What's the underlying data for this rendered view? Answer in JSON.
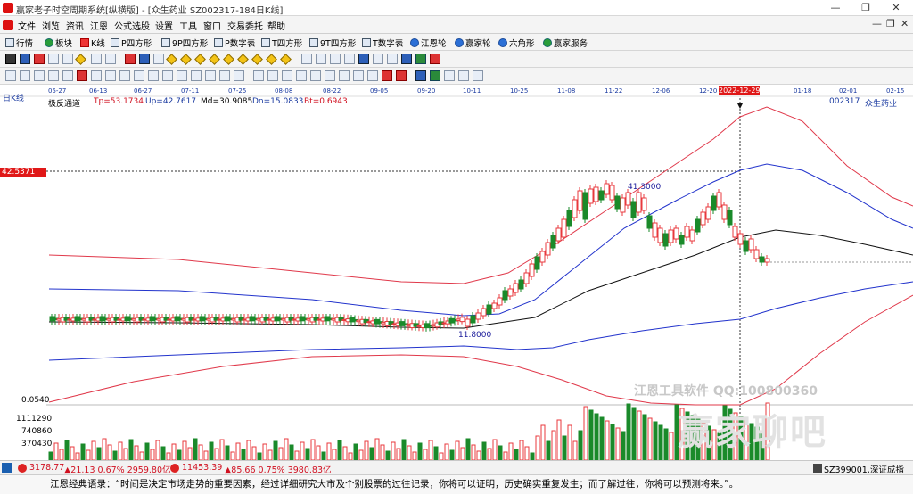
{
  "window": {
    "title": "赢家老子时空周期系统[纵横版] - [众生药业 SZ002317-184日K线]",
    "minimize": "—",
    "maximize": "❐",
    "close": "✕"
  },
  "menu": {
    "items": [
      "文件",
      "浏览",
      "资讯",
      "江恩",
      "公式选股",
      "设置",
      "工具",
      "窗口",
      "交易委托",
      "帮助"
    ],
    "right_min": "—",
    "right_restore": "❐",
    "right_close": "✕"
  },
  "toolbar1": {
    "items": [
      "行情",
      "板块",
      "K线",
      "P四方形",
      "9P四方形",
      "P数字表",
      "T四方形",
      "9T四方形",
      "T数字表",
      "江恩轮",
      "赢家轮",
      "六角形",
      "赢家服务"
    ]
  },
  "chart": {
    "period_label": "日K线",
    "indicator_name": "极反通道",
    "tp": "Tp=53.1734",
    "up": "Up=42.7617",
    "md": "Md=30.9085",
    "dn": "Dn=15.0833",
    "bt": "Bt=0.6943",
    "stock_code": "002317",
    "stock_name": "众生药业",
    "cursor_price": "42.5371",
    "cursor_date": "2022-12-29",
    "high_label": "41.3000",
    "low_label": "11.8000",
    "vol_axis_top": "0.0540",
    "vol_ticks": [
      "1111290",
      "740860",
      "370430"
    ],
    "dates": [
      "05-27",
      "06-13",
      "06-27",
      "07-11",
      "07-25",
      "08-08",
      "08-22",
      "09-05",
      "09-20",
      "10-11",
      "10-25",
      "11-08",
      "11-22",
      "12-06",
      "12-20",
      "2022-12-29",
      "01-18",
      "02-01",
      "02-15"
    ],
    "colors": {
      "up": "#e8383d",
      "down": "#1a8a2a",
      "upper": "#e0384a",
      "mid_band": "#2233cc",
      "middle": "#111111"
    }
  },
  "chart_data": {
    "type": "candlestick",
    "series": [
      {
        "name": "Tp",
        "values": [
          53.1734
        ]
      },
      {
        "name": "Up",
        "values": [
          42.7617
        ]
      },
      {
        "name": "Md",
        "values": [
          30.9085
        ]
      },
      {
        "name": "Dn",
        "values": [
          15.0833
        ]
      },
      {
        "name": "Bt",
        "values": [
          0.6943
        ]
      }
    ],
    "annotations": [
      "41.3000",
      "11.8000"
    ],
    "volume_ticks": [
      1111290,
      740860,
      370430
    ]
  },
  "statusbar": {
    "sh_index": "3178.77",
    "sh_change": "▲21.13 0.67% 2959.80亿",
    "sz_index": "11453.39",
    "sz_change": "▲85.66 0.75% 3980.83亿",
    "right_code": "SZ399001,深证成指"
  },
  "quote": {
    "text": "江恩经典语录：“时间是决定市场走势的重要因素，经过详细研究大市及个别股票的过往记录，你将可以证明，历史确实重复发生；而了解过往，你将可以预测将来。”。"
  },
  "watermark": {
    "line1": "江恩工具软件  QQ:100800360",
    "line2": "赢家聊吧"
  }
}
